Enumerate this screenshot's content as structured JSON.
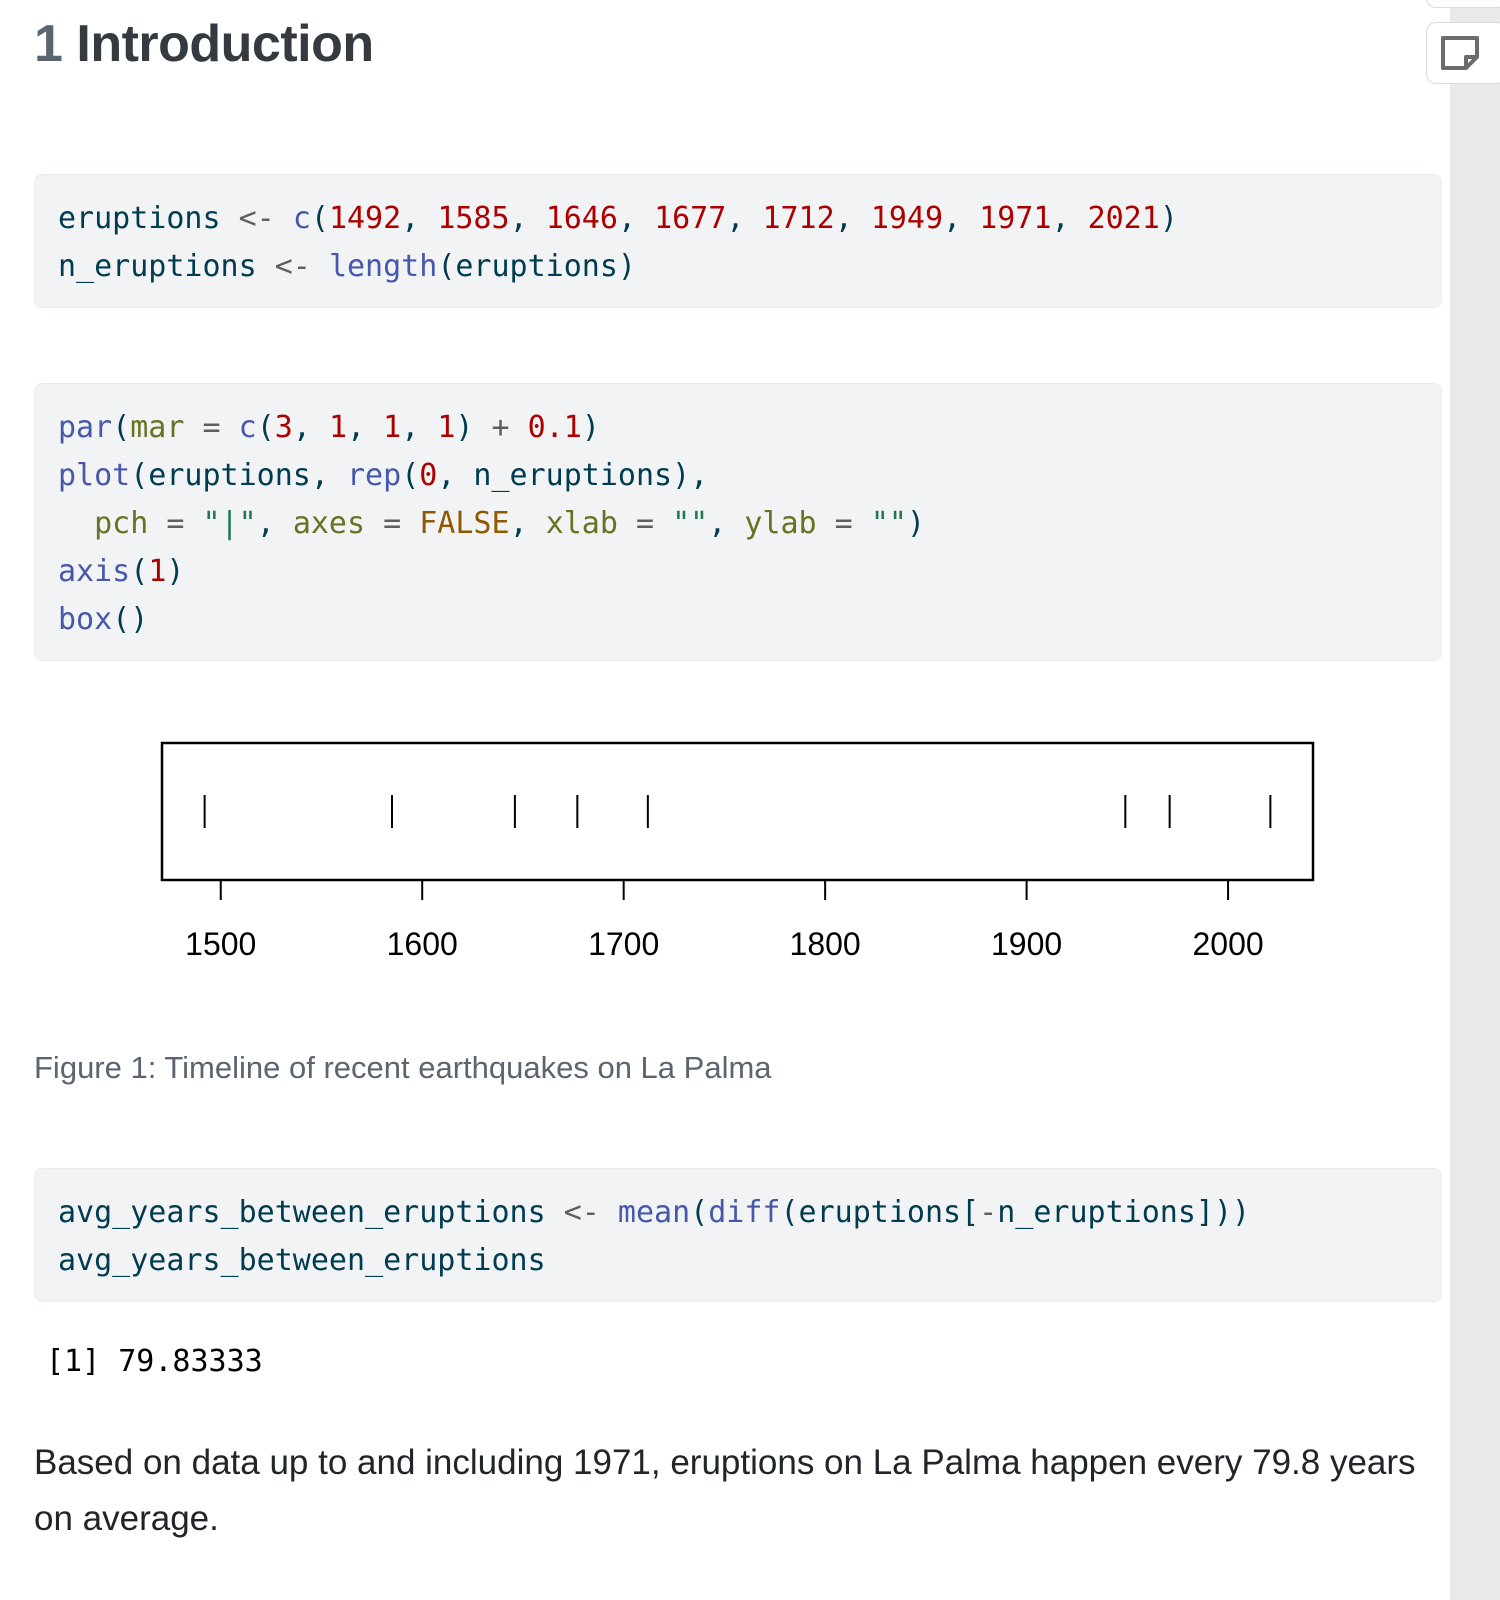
{
  "section": {
    "number": "1",
    "title": "Introduction"
  },
  "code_blocks": [
    {
      "lines": [
        [
          {
            "t": "eruptions ",
            "c": ""
          },
          {
            "t": "<-",
            "c": "op"
          },
          {
            "t": " ",
            "c": ""
          },
          {
            "t": "c",
            "c": "fn"
          },
          {
            "t": "(",
            "c": ""
          },
          {
            "t": "1492",
            "c": "nm"
          },
          {
            "t": ", ",
            "c": ""
          },
          {
            "t": "1585",
            "c": "nm"
          },
          {
            "t": ", ",
            "c": ""
          },
          {
            "t": "1646",
            "c": "nm"
          },
          {
            "t": ", ",
            "c": ""
          },
          {
            "t": "1677",
            "c": "nm"
          },
          {
            "t": ", ",
            "c": ""
          },
          {
            "t": "1712",
            "c": "nm"
          },
          {
            "t": ", ",
            "c": ""
          },
          {
            "t": "1949",
            "c": "nm"
          },
          {
            "t": ", ",
            "c": ""
          },
          {
            "t": "1971",
            "c": "nm"
          },
          {
            "t": ", ",
            "c": ""
          },
          {
            "t": "2021",
            "c": "nm"
          },
          {
            "t": ")",
            "c": ""
          }
        ],
        [
          {
            "t": "n_eruptions ",
            "c": ""
          },
          {
            "t": "<-",
            "c": "op"
          },
          {
            "t": " ",
            "c": ""
          },
          {
            "t": "length",
            "c": "fn"
          },
          {
            "t": "(eruptions)",
            "c": ""
          }
        ]
      ]
    },
    {
      "lines": [
        [
          {
            "t": "par",
            "c": "fn"
          },
          {
            "t": "(",
            "c": ""
          },
          {
            "t": "mar",
            "c": "ar"
          },
          {
            "t": " = ",
            "c": "op"
          },
          {
            "t": "c",
            "c": "fn"
          },
          {
            "t": "(",
            "c": ""
          },
          {
            "t": "3",
            "c": "nm"
          },
          {
            "t": ", ",
            "c": ""
          },
          {
            "t": "1",
            "c": "nm"
          },
          {
            "t": ", ",
            "c": ""
          },
          {
            "t": "1",
            "c": "nm"
          },
          {
            "t": ", ",
            "c": ""
          },
          {
            "t": "1",
            "c": "nm"
          },
          {
            "t": ") ",
            "c": ""
          },
          {
            "t": "+",
            "c": "op"
          },
          {
            "t": " ",
            "c": ""
          },
          {
            "t": "0.1",
            "c": "nm"
          },
          {
            "t": ")",
            "c": ""
          }
        ],
        [
          {
            "t": "plot",
            "c": "fn"
          },
          {
            "t": "(eruptions, ",
            "c": ""
          },
          {
            "t": "rep",
            "c": "fn"
          },
          {
            "t": "(",
            "c": ""
          },
          {
            "t": "0",
            "c": "nm"
          },
          {
            "t": ", n_eruptions),",
            "c": ""
          }
        ],
        [
          {
            "t": "  ",
            "c": ""
          },
          {
            "t": "pch",
            "c": "ar"
          },
          {
            "t": " = ",
            "c": "op"
          },
          {
            "t": "\"|\"",
            "c": "st"
          },
          {
            "t": ", ",
            "c": ""
          },
          {
            "t": "axes",
            "c": "ar"
          },
          {
            "t": " = ",
            "c": "op"
          },
          {
            "t": "FALSE",
            "c": "kw"
          },
          {
            "t": ", ",
            "c": ""
          },
          {
            "t": "xlab",
            "c": "ar"
          },
          {
            "t": " = ",
            "c": "op"
          },
          {
            "t": "\"\"",
            "c": "st"
          },
          {
            "t": ", ",
            "c": ""
          },
          {
            "t": "ylab",
            "c": "ar"
          },
          {
            "t": " = ",
            "c": "op"
          },
          {
            "t": "\"\"",
            "c": "st"
          },
          {
            "t": ")",
            "c": ""
          }
        ],
        [
          {
            "t": "axis",
            "c": "fn"
          },
          {
            "t": "(",
            "c": ""
          },
          {
            "t": "1",
            "c": "nm"
          },
          {
            "t": ")",
            "c": ""
          }
        ],
        [
          {
            "t": "box",
            "c": "fn"
          },
          {
            "t": "()",
            "c": ""
          }
        ]
      ]
    },
    {
      "lines": [
        [
          {
            "t": "avg_years_between_eruptions ",
            "c": ""
          },
          {
            "t": "<-",
            "c": "op"
          },
          {
            "t": " ",
            "c": ""
          },
          {
            "t": "mean",
            "c": "fn"
          },
          {
            "t": "(",
            "c": ""
          },
          {
            "t": "diff",
            "c": "fn"
          },
          {
            "t": "(eruptions[",
            "c": ""
          },
          {
            "t": "-",
            "c": "op"
          },
          {
            "t": "n_eruptions]))",
            "c": ""
          }
        ],
        [
          {
            "t": "avg_years_between_eruptions",
            "c": ""
          }
        ]
      ]
    }
  ],
  "chart_data": {
    "type": "scatter",
    "title": "",
    "xlabel": "",
    "ylabel": "",
    "marker": "|",
    "x": [
      1492,
      1585,
      1646,
      1677,
      1712,
      1949,
      1971,
      2021
    ],
    "y": [
      0,
      0,
      0,
      0,
      0,
      0,
      0,
      0
    ],
    "xlim": [
      1470.84,
      2042.16
    ],
    "xticks": [
      1500,
      1600,
      1700,
      1800,
      1900,
      2000
    ],
    "tick_labels": [
      "1500",
      "1600",
      "1700",
      "1800",
      "1900",
      "2000"
    ],
    "grid": false,
    "box": true
  },
  "figure_caption": "Figure 1: Timeline of recent earthquakes on La Palma",
  "output_text": "[1] 79.83333",
  "paragraph": "Based on data up to and including 1971, eruptions on La Palma happen every 79.8 years on average.",
  "toolbar": {
    "note_icon": "sticky-note-icon"
  }
}
